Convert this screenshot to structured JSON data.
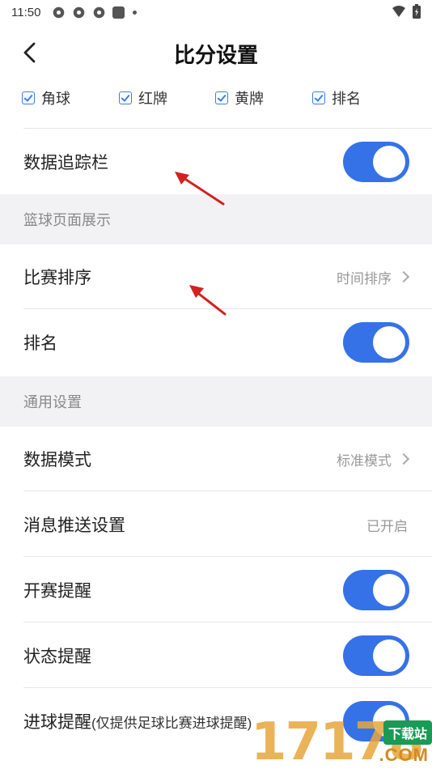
{
  "status_bar": {
    "time": "11:50"
  },
  "nav": {
    "title": "比分设置"
  },
  "filters": [
    {
      "label": "角球",
      "checked": true
    },
    {
      "label": "红牌",
      "checked": true
    },
    {
      "label": "黄牌",
      "checked": true
    },
    {
      "label": "排名",
      "checked": true
    }
  ],
  "rows": {
    "data_tracker": {
      "label": "数据追踪栏",
      "on": true
    },
    "match_sort": {
      "label": "比赛排序",
      "value": "时间排序"
    },
    "ranking": {
      "label": "排名",
      "on": true
    },
    "data_mode": {
      "label": "数据模式",
      "value": "标准模式"
    },
    "push_settings": {
      "label": "消息推送设置",
      "value": "已开启"
    },
    "kickoff_reminder": {
      "label": "开赛提醒",
      "on": true
    },
    "status_reminder": {
      "label": "状态提醒",
      "on": true
    },
    "goal_reminder": {
      "label": "进球提醒",
      "note": "(仅提供足球比赛进球提醒)",
      "on": true
    }
  },
  "sections": {
    "basketball": "篮球页面展示",
    "general": "通用设置"
  },
  "watermark": {
    "digits": "17178",
    "badge": "下载站",
    "domain": ".COM"
  },
  "colors": {
    "accent": "#3572e8",
    "arrow": "#d42020",
    "section_bg": "#f2f2f4"
  }
}
